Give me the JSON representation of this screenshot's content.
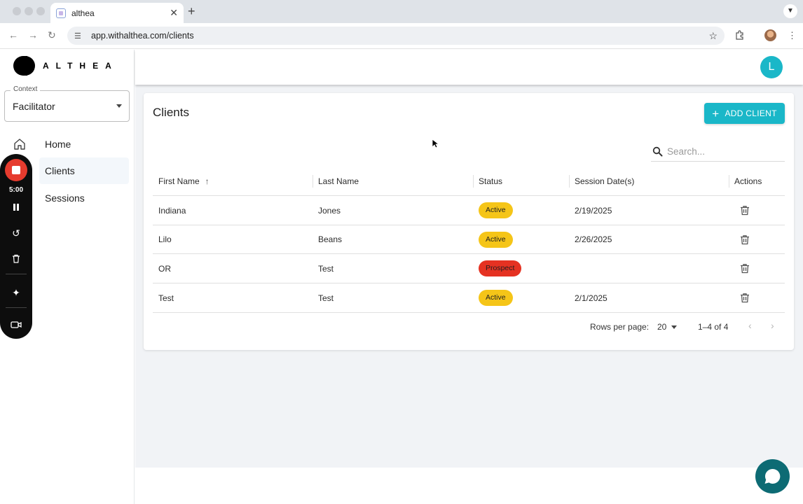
{
  "browser": {
    "tab_title": "althea",
    "url": "app.withalthea.com/clients",
    "close_glyph": "✕",
    "newtab_glyph": "+"
  },
  "sidebar": {
    "logo_text": "ALTHEA",
    "context": {
      "label": "Context",
      "value": "Facilitator"
    },
    "items": [
      {
        "label": "Home",
        "icon": "home-icon"
      },
      {
        "label": "Clients",
        "active": true
      },
      {
        "label": "Sessions"
      }
    ]
  },
  "recorder": {
    "time": "5:00",
    "icons": [
      "stop-record-icon",
      "pause-icon",
      "restart-icon",
      "trash-icon",
      "effects-icon",
      "camera-icon"
    ]
  },
  "header": {
    "user_initial": "L",
    "avatar_color": "#1ab7c8"
  },
  "clients": {
    "title": "Clients",
    "add_button": "ADD CLIENT",
    "search_placeholder": "Search...",
    "columns": [
      "First Name",
      "Last Name",
      "Status",
      "Session Date(s)",
      "Actions"
    ],
    "rows": [
      {
        "first": "Indiana",
        "last": "Jones",
        "status": "Active",
        "date": "2/19/2025"
      },
      {
        "first": "Lilo",
        "last": "Beans",
        "status": "Active",
        "date": "2/26/2025"
      },
      {
        "first": "OR",
        "last": "Test",
        "status": "Prospect",
        "date": ""
      },
      {
        "first": "Test",
        "last": "Test",
        "status": "Active",
        "date": "2/1/2025"
      }
    ],
    "pagination": {
      "rows_per_page_label": "Rows per page:",
      "rows_per_page": "20",
      "range": "1–4 of 4"
    }
  },
  "colors": {
    "accent": "#1ab7c8",
    "active_chip": "#f5c518",
    "prospect_chip": "#e53222",
    "chat": "#0d6b74"
  }
}
